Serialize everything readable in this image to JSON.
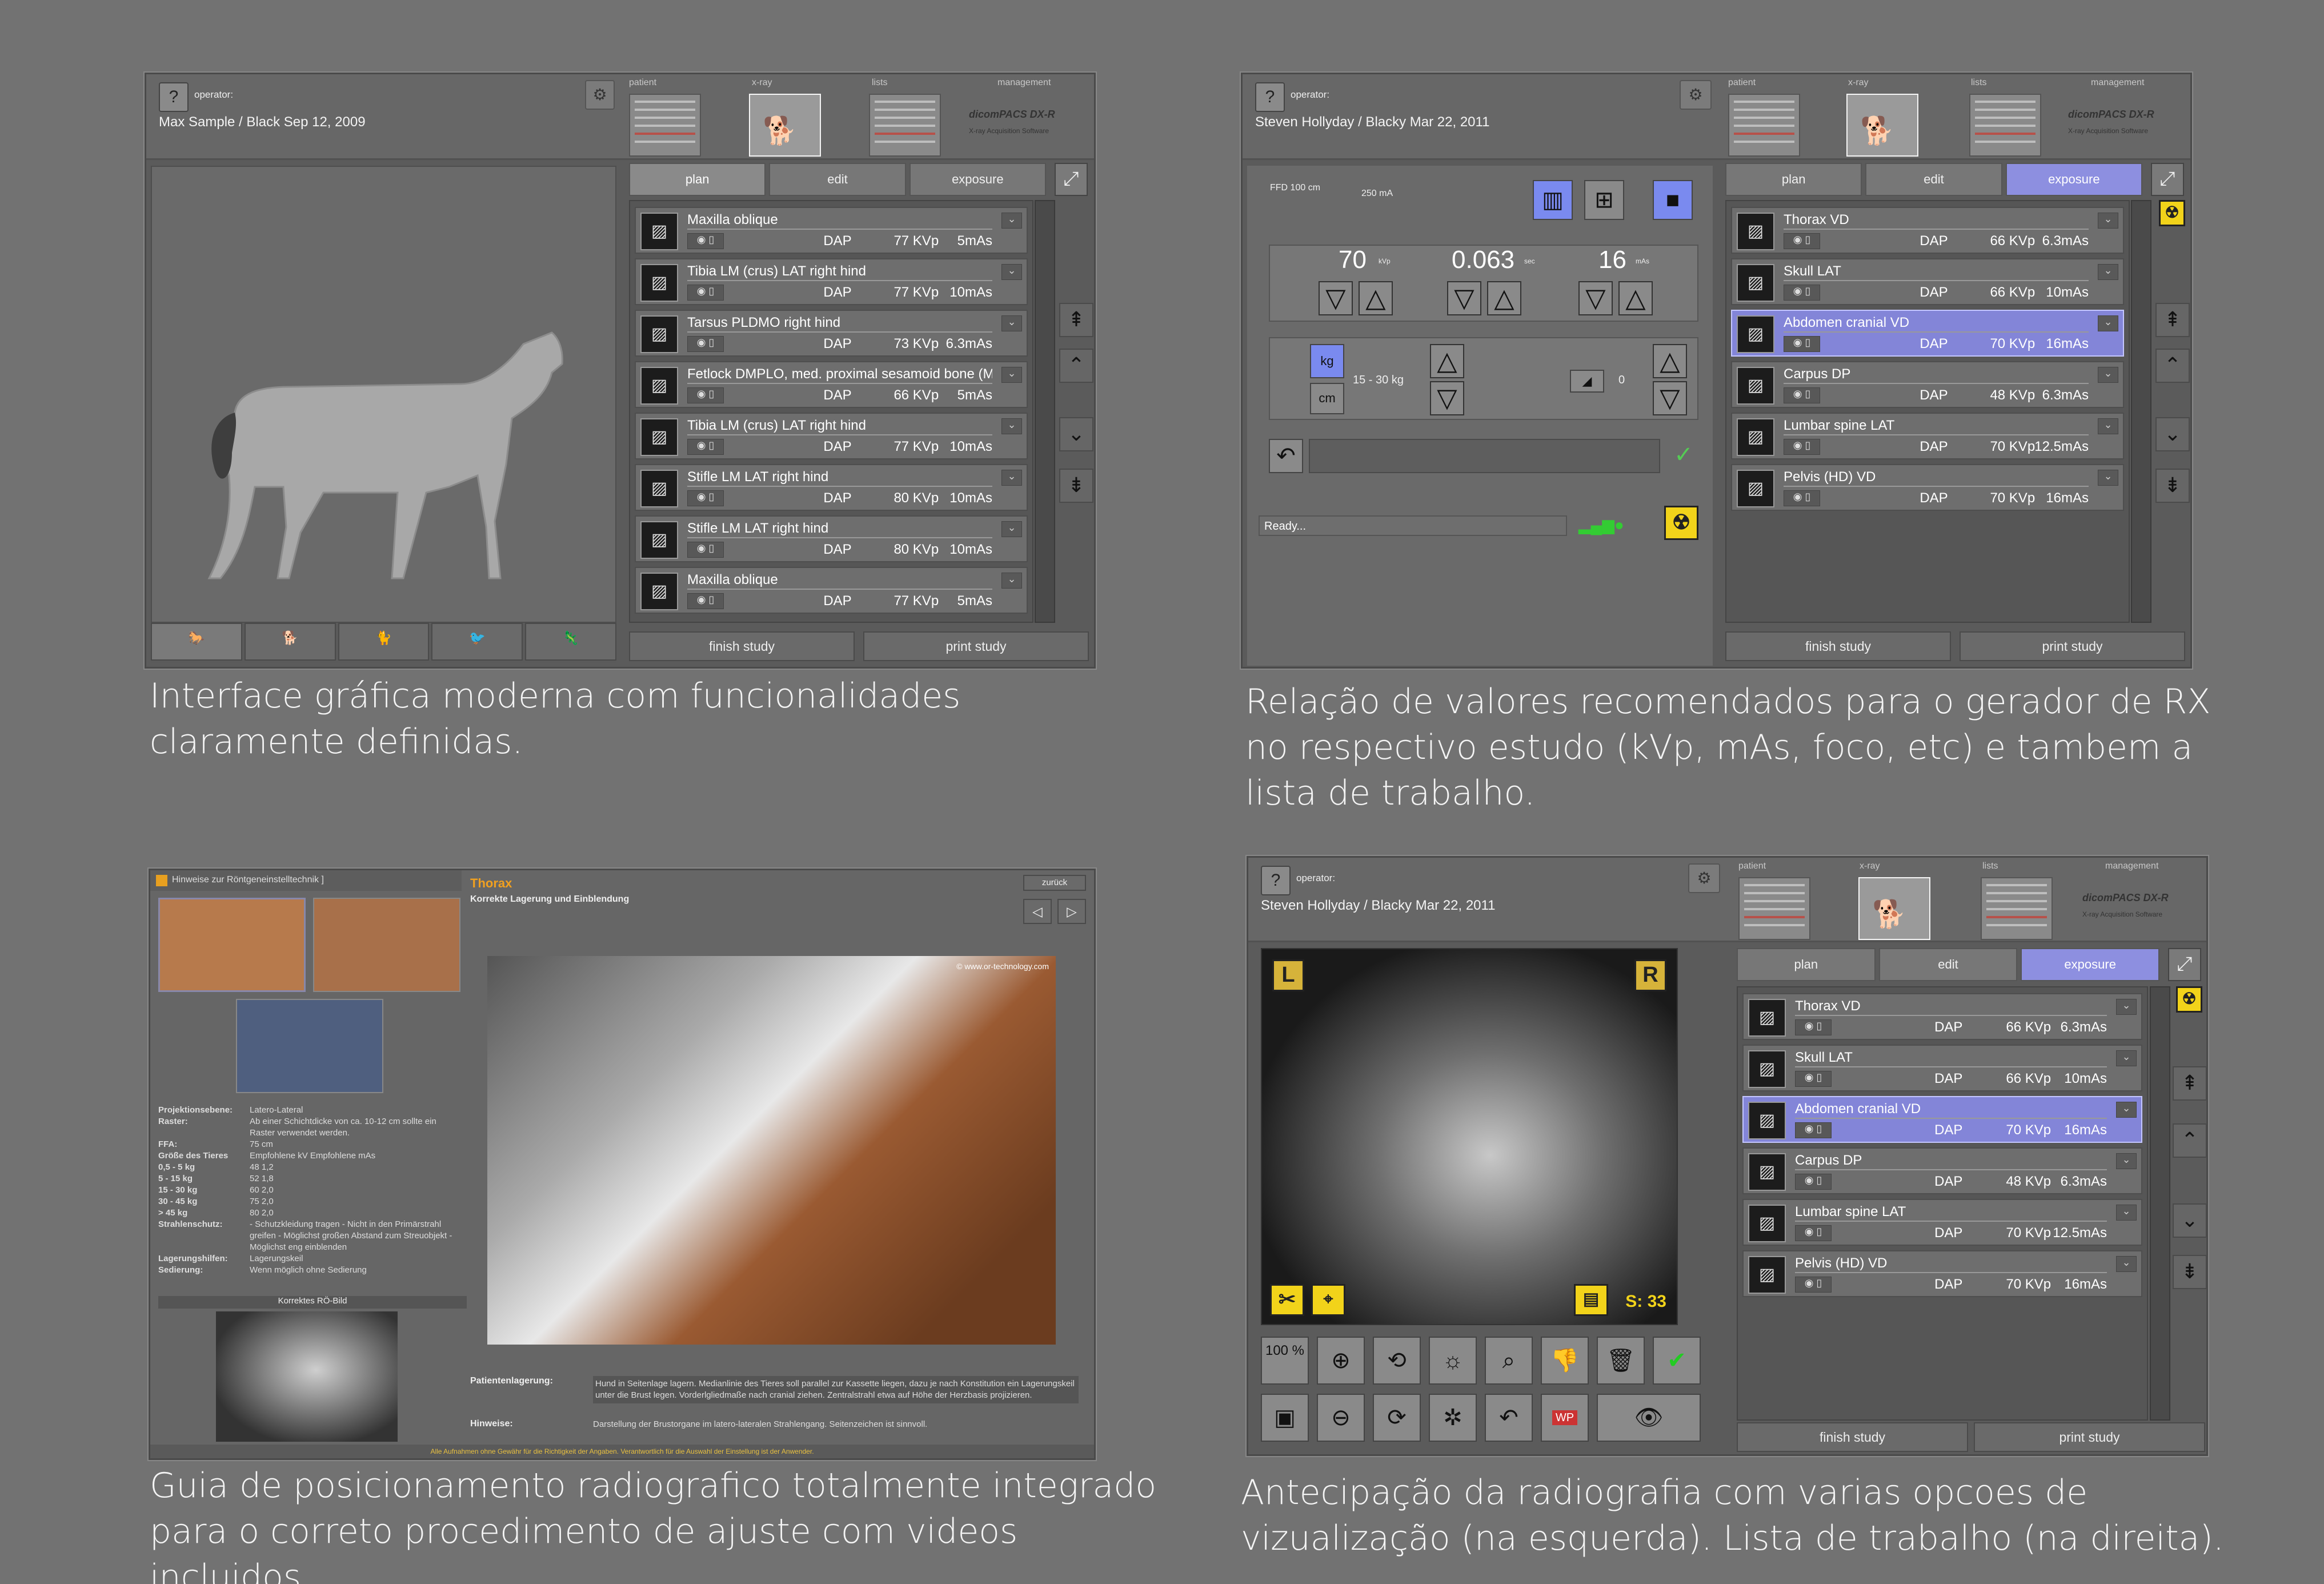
{
  "panel1": {
    "operator_label": "operator:",
    "patient": "Max Sample / Black  Sep 12, 2009",
    "tabs": {
      "patient": "patient",
      "xray": "x-ray",
      "lists": "lists",
      "management": "management"
    },
    "brand": "dicomPACS DX-R",
    "brand_sub": "X-ray Acquisition Software",
    "work_tabs": [
      "plan",
      "edit",
      "exposure"
    ],
    "active_tab": "plan",
    "items": [
      {
        "name": "Maxilla oblique",
        "dap": "DAP",
        "kvp": "77 KVp",
        "mas": "5mAs"
      },
      {
        "name": "Tibia LM (crus) LAT right hind",
        "dap": "DAP",
        "kvp": "77 KVp",
        "mas": "10mAs"
      },
      {
        "name": "Tarsus PLDMO right hind",
        "dap": "DAP",
        "kvp": "73 KVp",
        "mas": "6.3mAs"
      },
      {
        "name": "Fetlock DMPLO, med. proximal sesamoid bone (M...",
        "dap": "DAP",
        "kvp": "66 KVp",
        "mas": "5mAs"
      },
      {
        "name": "Tibia LM (crus) LAT right hind",
        "dap": "DAP",
        "kvp": "77 KVp",
        "mas": "10mAs"
      },
      {
        "name": "Stifle LM LAT right hind",
        "dap": "DAP",
        "kvp": "80 KVp",
        "mas": "10mAs"
      },
      {
        "name": "Stifle LM LAT right hind",
        "dap": "DAP",
        "kvp": "80 KVp",
        "mas": "10mAs"
      },
      {
        "name": "Maxilla oblique",
        "dap": "DAP",
        "kvp": "77 KVp",
        "mas": "5mAs"
      }
    ],
    "finish": "finish study",
    "print": "print study",
    "caption": "Interface gráfica moderna com funcionalidades claramente definidas."
  },
  "panel2": {
    "operator_label": "operator:",
    "patient": "Steven Hollyday / Blacky  Mar 22, 2011",
    "tabs": {
      "patient": "patient",
      "xray": "x-ray",
      "lists": "lists",
      "management": "management"
    },
    "brand": "dicomPACS DX-R",
    "brand_sub": "X-ray Acquisition Software",
    "ffd": "FFD 100 cm",
    "ma": "250 mA",
    "kv_value": "70",
    "kv_unit": "kVp",
    "sec_value": "0.063",
    "sec_unit": "sec",
    "mas_value": "16",
    "mas_unit": "mAs",
    "kg": "kg",
    "cm": "cm",
    "weight_range": "15 - 30 kg",
    "density": "0",
    "status": "Ready...",
    "work_tabs": [
      "plan",
      "edit",
      "exposure"
    ],
    "active_tab": "exposure",
    "items": [
      {
        "name": "Thorax VD",
        "dap": "DAP",
        "kvp": "66 KVp",
        "mas": "6.3mAs"
      },
      {
        "name": "Skull LAT",
        "dap": "DAP",
        "kvp": "66 KVp",
        "mas": "10mAs"
      },
      {
        "name": "Abdomen cranial VD",
        "dap": "DAP",
        "kvp": "70 KVp",
        "mas": "16mAs"
      },
      {
        "name": "Carpus DP",
        "dap": "DAP",
        "kvp": "48 KVp",
        "mas": "6.3mAs"
      },
      {
        "name": "Lumbar spine LAT",
        "dap": "DAP",
        "kvp": "70 KVp",
        "mas": "12.5mAs"
      },
      {
        "name": "Pelvis (HD) VD",
        "dap": "DAP",
        "kvp": "70 KVp",
        "mas": "16mAs"
      }
    ],
    "selected_index": 2,
    "finish": "finish study",
    "print": "print study",
    "caption": "Relação de valores recomendados para o gerador de RX no respectivo estudo (kVp, mAs, foco, etc) e tambem a lista de trabalho."
  },
  "panel3": {
    "window_title": "Hinweise zur Röntgeneinstelltechnik ]",
    "section": "Thorax",
    "subtitle": "Korrekte Lagerung und Einblendung",
    "back": "zurück",
    "watermark": "© www.or-technology.com",
    "table": [
      [
        "Projektionsebene:",
        "Latero-Lateral"
      ],
      [
        "Raster:",
        "Ab einer Schichtdicke von ca. 10-12 cm sollte ein Raster verwendet werden."
      ],
      [
        "FFA:",
        "75 cm"
      ],
      [
        "Größe des Tieres",
        "Empfohlene kV   Empfohlene mAs"
      ],
      [
        "0,5 - 5 kg",
        "48   1,2"
      ],
      [
        "5 - 15 kg",
        "52   1,8"
      ],
      [
        "15 - 30 kg",
        "60   2,0"
      ],
      [
        "30 - 45 kg",
        "75   2,0"
      ],
      [
        "> 45 kg",
        "80   2,0"
      ],
      [
        "Strahlenschutz:",
        "- Schutzkleidung tragen - Nicht in den Primärstrahl greifen - Möglichst großen Abstand zum Streuobjekt - Möglichst eng einblenden"
      ],
      [
        "Lagerungshilfen:",
        "Lagerungskeil"
      ],
      [
        "Sedierung:",
        "Wenn möglich ohne Sedierung"
      ]
    ],
    "correct_image": "Korrektes RÖ-Bild",
    "positioning_label": "Patientenlagerung:",
    "positioning_text": "Hund in Seitenlage lagern. Medianlinie des Tieres soll parallel zur Kassette liegen, dazu je nach Konstitution ein Lagerungskeil unter die Brust legen. Vorderlgliedmaße nach cranial ziehen. Zentralstrahl etwa auf Höhe der Herzbasis projizieren.",
    "hints_label": "Hinweise:",
    "hints_text": "Darstellung der Brustorgane im latero-lateralen Strahlengang. Seitenzeichen ist sinnvoll.",
    "footer_warning": "Alle Aufnahmen ohne Gewähr für die Richtigkeit der Angaben. Verantwortlich für die Auswahl der Einstellung ist der Anwender.",
    "caption": "Guia  de  posicionamento radiografico totalmente integrado para o correto procedimento de ajuste com videos incluidos."
  },
  "panel4": {
    "operator_label": "operator:",
    "patient": "Steven Hollyday / Blacky  Mar 22, 2011",
    "tabs": {
      "patient": "patient",
      "xray": "x-ray",
      "lists": "lists",
      "management": "management"
    },
    "brand": "dicomPACS DX-R",
    "brand_sub": "X-ray Acquisition Software",
    "marker_l": "L",
    "marker_r": "R",
    "s_value": "S: 33",
    "zoom": "100 %",
    "wp": "WP",
    "work_tabs": [
      "plan",
      "edit",
      "exposure"
    ],
    "active_tab": "exposure",
    "items": [
      {
        "name": "Thorax VD",
        "dap": "DAP",
        "kvp": "66 KVp",
        "mas": "6.3mAs"
      },
      {
        "name": "Skull LAT",
        "dap": "DAP",
        "kvp": "66 KVp",
        "mas": "10mAs"
      },
      {
        "name": "Abdomen cranial VD",
        "dap": "DAP",
        "kvp": "70 KVp",
        "mas": "16mAs"
      },
      {
        "name": "Carpus DP",
        "dap": "DAP",
        "kvp": "48 KVp",
        "mas": "6.3mAs"
      },
      {
        "name": "Lumbar spine LAT",
        "dap": "DAP",
        "kvp": "70 KVp",
        "mas": "12.5mAs"
      },
      {
        "name": "Pelvis (HD) VD",
        "dap": "DAP",
        "kvp": "70 KVp",
        "mas": "16mAs"
      }
    ],
    "selected_index": 2,
    "finish": "finish study",
    "print": "print study",
    "caption": "Antecipação da radiografia com varias opcoes de vizualização (na esquerda).   Lista de trabalho (na direita)."
  },
  "colors": {
    "selected": "#8385d8",
    "hazard": "#f2d31a",
    "brand_red": "#d0392b",
    "background": "#727272"
  }
}
